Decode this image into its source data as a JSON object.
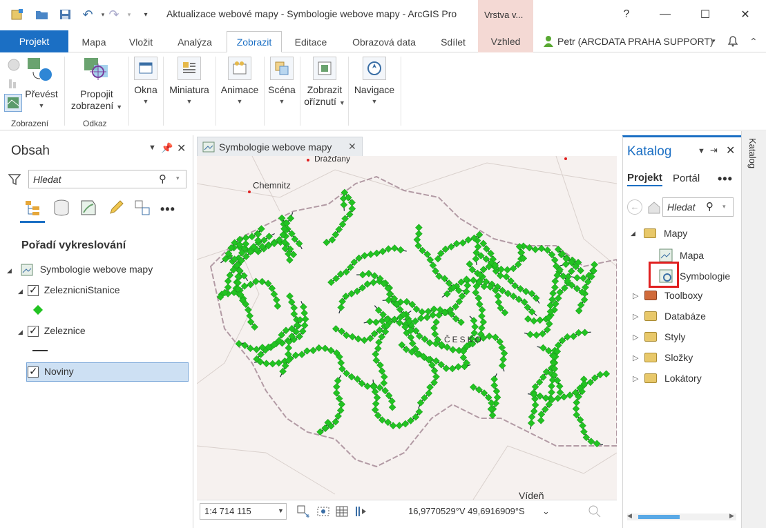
{
  "window": {
    "title": "Aktualizace webové mapy - Symbologie webove mapy - ArcGIS Pro",
    "context_tab": "Vrstva v...",
    "help": "?",
    "minimize": "—",
    "maximize": "☐",
    "close": "✕"
  },
  "tabs": [
    {
      "label": "Projekt"
    },
    {
      "label": "Mapa"
    },
    {
      "label": "Vložit"
    },
    {
      "label": "Analýza"
    },
    {
      "label": "Zobrazit"
    },
    {
      "label": "Editace"
    },
    {
      "label": "Obrazová data"
    },
    {
      "label": "Sdílet"
    },
    {
      "label": "Vzhled"
    }
  ],
  "user": {
    "name": "Petr (ARCDATA PRAHA SUPPORT)"
  },
  "ribbon": {
    "prevest": "Převést",
    "propojit_1": "Propojit",
    "propojit_2": "zobrazení",
    "okna": "Okna",
    "miniatura": "Miniatura",
    "animace": "Animace",
    "scena": "Scéna",
    "zobrazit_1": "Zobrazit",
    "zobrazit_2": "oříznutí",
    "navigace": "Navigace",
    "group_zobrazeni": "Zobrazení",
    "group_odkaz": "Odkaz"
  },
  "contents": {
    "title": "Obsah",
    "search_placeholder": "Hledat",
    "draw_order": "Pořadí vykreslování",
    "map_name": "Symbologie webove mapy",
    "layers": [
      {
        "name": "ZeleznicniStanice"
      },
      {
        "name": "Zeleznice"
      },
      {
        "name": "Noviny"
      }
    ]
  },
  "mapview": {
    "tab_label": "Symbologie webove mapy",
    "scale": "1:4 714 115",
    "coords": "16,9770529°V 49,6916909°S",
    "labels": [
      "Drážďany",
      "Chemnitz",
      "ČESKO",
      "Vídeň"
    ]
  },
  "catalog": {
    "title": "Katalog",
    "tab_projekt": "Projekt",
    "tab_portal": "Portál",
    "search_placeholder": "Hledat",
    "items": [
      {
        "label": "Mapy"
      },
      {
        "label": "Mapa"
      },
      {
        "label": "Symbologie"
      },
      {
        "label": "Toolboxy"
      },
      {
        "label": "Databáze"
      },
      {
        "label": "Styly"
      },
      {
        "label": "Složky"
      },
      {
        "label": "Lokátory"
      }
    ],
    "side_label": "Katalog"
  },
  "colors": {
    "accent": "#1b6fc4",
    "station_green": "#22c322",
    "highlight_red": "#e02020",
    "selected_row": "#cde0f3"
  }
}
